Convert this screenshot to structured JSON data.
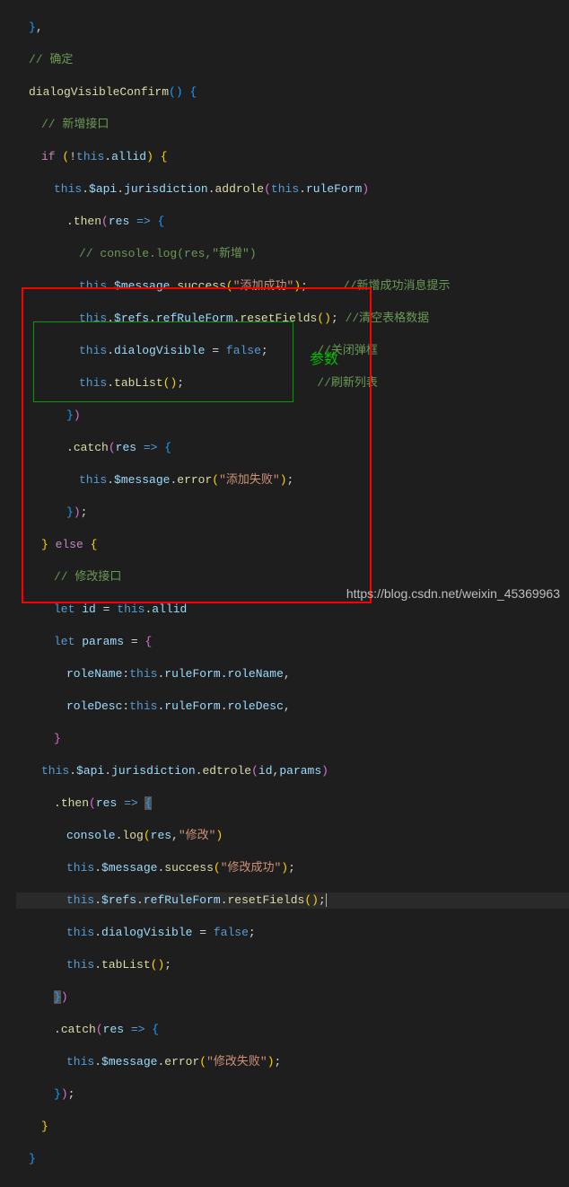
{
  "code": {
    "l1": "// 确定",
    "l2_fn": "dialogVisibleConfirm",
    "l3": "// 新增接口",
    "l4_if": "if",
    "l4_this": "this",
    "l4_allid": "allid",
    "l5_this": "this",
    "l5_api": "$api",
    "l5_jur": "jurisdiction",
    "l5_addrole": "addrole",
    "l5_this2": "this",
    "l5_ruleform": "ruleForm",
    "l6_then": "then",
    "l6_res": "res",
    "l7": "// console.log(res,\"新增\")",
    "l8_this": "this",
    "l8_msg": "$message",
    "l8_success": "success",
    "l8_str": "\"添加成功\"",
    "l8_cmt": "//新增成功消息提示",
    "l9_this": "this",
    "l9_refs": "$refs",
    "l9_rrf": "refRuleForm",
    "l9_reset": "resetFields",
    "l9_cmt": "//清空表格数据",
    "l10_this": "this",
    "l10_dv": "dialogVisible",
    "l10_false": "false",
    "l10_cmt": "//关闭弹框",
    "l11_this": "this",
    "l11_tl": "tabList",
    "l11_cmt": "//刷新列表",
    "l13_catch": "catch",
    "l13_res": "res",
    "l14_this": "this",
    "l14_msg": "$message",
    "l14_error": "error",
    "l14_str": "\"添加失败\"",
    "l16_else": "else",
    "l17": "// 修改接口",
    "l18_let": "let",
    "l18_id": "id",
    "l18_this": "this",
    "l18_allid": "allid",
    "l19_let": "let",
    "l19_params": "params",
    "l20_rn": "roleName",
    "l20_this": "this",
    "l20_rf": "ruleForm",
    "l20_rn2": "roleName",
    "l21_rd": "roleDesc",
    "l21_this": "this",
    "l21_rf": "ruleForm",
    "l21_rd2": "roleDesc",
    "l23_this": "this",
    "l23_api": "$api",
    "l23_jur": "jurisdiction",
    "l23_edt": "edtrole",
    "l23_id": "id",
    "l23_params": "params",
    "l24_then": "then",
    "l24_res": "res",
    "l25_cl": "console",
    "l25_log": "log",
    "l25_res": "res",
    "l25_str": "\"修改\"",
    "l26_this": "this",
    "l26_msg": "$message",
    "l26_success": "success",
    "l26_str": "\"修改成功\"",
    "l27_this": "this",
    "l27_refs": "$refs",
    "l27_rrf": "refRuleForm",
    "l27_reset": "resetFields",
    "l28_this": "this",
    "l28_dv": "dialogVisible",
    "l28_false": "false",
    "l29_this": "this",
    "l29_tl": "tabList",
    "l31_catch": "catch",
    "l31_res": "res",
    "l32_this": "this",
    "l32_msg": "$message",
    "l32_error": "error",
    "l32_str": "\"修改失败\""
  },
  "annotations": {
    "green_label": "参数",
    "watermark": "https://blog.csdn.net/weixin_45369963"
  }
}
